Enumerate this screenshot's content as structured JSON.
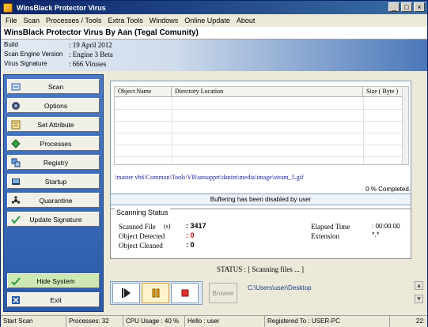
{
  "window": {
    "title": "WinsBlack Protector Virus"
  },
  "menu": [
    "File",
    "Scan",
    "Processes / Tools",
    "Extra Tools",
    "Windows",
    "Online Update",
    "About"
  ],
  "header": {
    "title": "WinsBlack Protector Virus By Aan (Tegal Comunity)"
  },
  "info": [
    {
      "label": "Build",
      "value": ": 19 April 2012"
    },
    {
      "label": "Scan Engine Version",
      "value": ": Engine 3 Beta"
    },
    {
      "label": "Virus Signature",
      "value": ": 666 Viruses"
    }
  ],
  "sidebar": {
    "items": [
      {
        "label": "Scan",
        "icon": "scan-icon"
      },
      {
        "label": "Options",
        "icon": "options-icon"
      },
      {
        "label": "Set Attribute",
        "icon": "attribute-icon"
      },
      {
        "label": "Processes",
        "icon": "processes-icon"
      },
      {
        "label": "Registry",
        "icon": "registry-icon"
      },
      {
        "label": "Startup",
        "icon": "startup-icon"
      },
      {
        "label": "Quarantine",
        "icon": "quarantine-icon"
      },
      {
        "label": "Update Signature",
        "icon": "update-icon"
      }
    ],
    "bottom": [
      {
        "label": "Hide System",
        "icon": "hide-icon"
      },
      {
        "label": "Exit",
        "icon": "exit-icon"
      }
    ]
  },
  "table": {
    "columns": [
      "Object Name",
      "Directory Location",
      "Size ( Byte )"
    ]
  },
  "current_path": "\\master vb6\\Common\\Tools\\VB\\unsupprt\\danim\\media\\image\\steam_5.gif",
  "progress": {
    "text": "0 % Completed.",
    "value": 0
  },
  "buffer_message": "Buffering has been disabled by user",
  "scanning": {
    "legend": "Scanning Status",
    "scanned_label": "Scanned File",
    "scanned_unit": "(s)",
    "scanned_value": ": 3417",
    "detected_label": "Object Detected",
    "detected_value": ": 0",
    "cleaned_label": "Object Cleaned",
    "cleaned_value": ": 0",
    "elapsed_label": "Elapsed Time",
    "elapsed_value": ": 00:00:00",
    "extension_label": "Extension",
    "extension_value": "*.*"
  },
  "status_text": "STATUS : [ Scanning files ... ]",
  "browse_label": "Browse",
  "folder": "C:\\Users\\user\\Desktop",
  "statusbar": [
    "Start Scan",
    "Processes: 32",
    "CPU Usage : 40 %",
    "Hello : user",
    "Registered To : USER-PC",
    "22:"
  ],
  "colors": {
    "title_bar": "#0a246a",
    "sidebar": "#3e6db8",
    "detected": "#d00000",
    "stop": "#e03030"
  }
}
